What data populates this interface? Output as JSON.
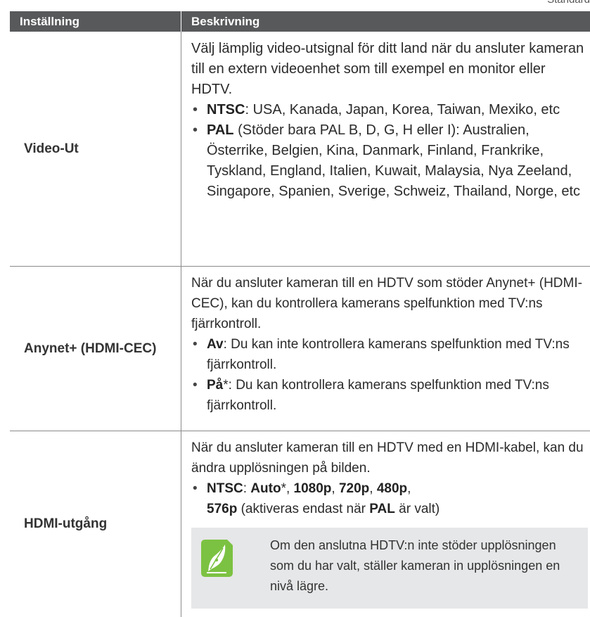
{
  "corner_text": "Standard",
  "header": {
    "col1": "Inställning",
    "col2": "Beskrivning"
  },
  "rows": [
    {
      "name": "Video-Ut",
      "intro": "Välj lämplig video-utsignal för ditt land när du ansluter kameran till en extern videoenhet som till exempel en monitor eller HDTV.",
      "bullets": [
        {
          "bold": "NTSC",
          "text": ": USA, Kanada, Japan, Korea, Taiwan, Mexiko, etc"
        },
        {
          "bold": "PAL",
          "text": " (Stöder bara PAL B, D, G, H eller I): Australien, Österrike, Belgien, Kina, Danmark, Finland, Frankrike, Tyskland, England, Italien, Kuwait, Malaysia, Nya Zeeland, Singapore, Spanien, Sverige, Schweiz, Thailand, Norge, etc"
        }
      ]
    },
    {
      "name": "Anynet+ (HDMI-CEC)",
      "intro": "När du ansluter kameran till en HDTV som stöder Anynet+ (HDMI-CEC), kan du kontrollera kamerans spelfunktion med TV:ns fjärrkontroll.",
      "bullets": [
        {
          "bold": "Av",
          "text": ": Du kan inte kontrollera kamerans spelfunktion med TV:ns fjärrkontroll."
        },
        {
          "bold": "På",
          "text": "*: Du kan kontrollera kamerans spelfunktion med TV:ns fjärrkontroll."
        }
      ]
    },
    {
      "name": "HDMI-utgång",
      "intro": "När du ansluter kameran till en HDTV med en HDMI-kabel, kan du ändra upplösningen på bilden.",
      "bullet": {
        "b1": "NTSC",
        "t1": ": ",
        "b2": "Auto",
        "t2": "*, ",
        "b3": "1080p",
        "t3": ", ",
        "b4": "720p",
        "t4": ", ",
        "b5": "480p",
        "t5": ", ",
        "b6": "576p",
        "t6": " (aktiveras endast när ",
        "b7": "PAL",
        "t7": " är valt)"
      },
      "note": "Om den anslutna HDTV:n inte stöder upplösningen som du har valt, ställer kameran in upplösningen en nivå lägre.",
      "note_icon": "pen-nib-icon",
      "note_icon_color": "#7cc242"
    }
  ]
}
